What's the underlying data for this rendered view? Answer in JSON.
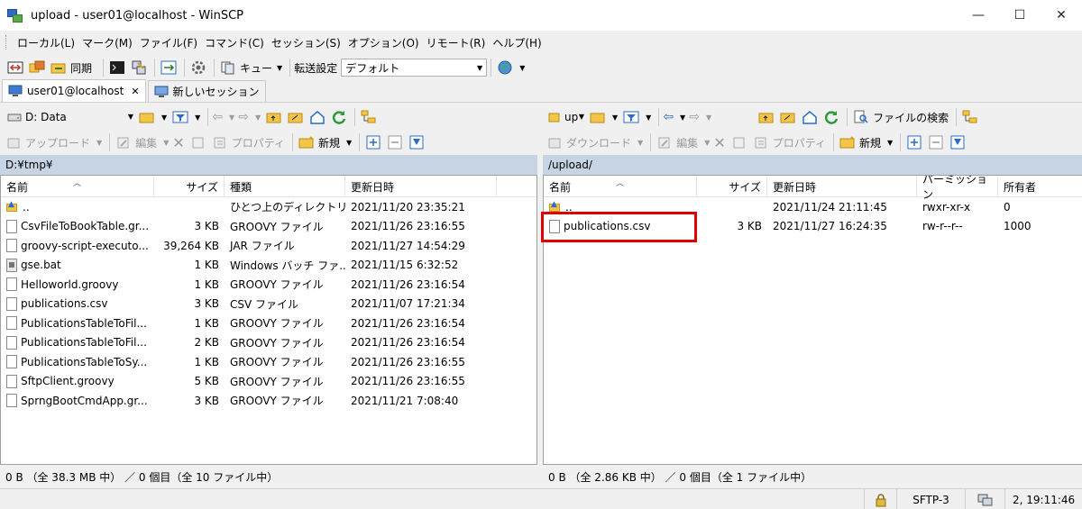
{
  "window": {
    "title": "upload - user01@localhost - WinSCP",
    "minimize": "—",
    "maximize": "☐",
    "close": "✕"
  },
  "menu": [
    "ローカル(L)",
    "マーク(M)",
    "ファイル(F)",
    "コマンド(C)",
    "セッション(S)",
    "オプション(O)",
    "リモート(R)",
    "ヘルプ(H)"
  ],
  "toolbar": {
    "sync": "同期",
    "queue": "キュー",
    "transfer_settings": "転送設定",
    "transfer_value": "デフォルト"
  },
  "tabs": {
    "session": "user01@localhost",
    "close": "✕",
    "new_session": "新しいセッション"
  },
  "local_toolbar": {
    "drive": "D: Data",
    "upload": "アップロード",
    "edit": "編集",
    "properties": "プロパティ",
    "new": "新規"
  },
  "remote_toolbar": {
    "drive": "up",
    "find": "ファイルの検索",
    "download": "ダウンロード",
    "edit": "編集",
    "properties": "プロパティ",
    "new": "新規"
  },
  "local": {
    "path": "D:¥tmp¥",
    "headers": {
      "name": "名前",
      "size": "サイズ",
      "type": "種類",
      "changed": "更新日時"
    },
    "files": [
      {
        "name": "..",
        "size": "",
        "type": "ひとつ上のディレクトリ",
        "changed": "2021/11/20  23:35:21",
        "icon": "up"
      },
      {
        "name": "CsvFileToBookTable.gr...",
        "size": "3 KB",
        "type": "GROOVY ファイル",
        "changed": "2021/11/26  23:16:55",
        "icon": "file"
      },
      {
        "name": "groovy-script-executo...",
        "size": "39,264 KB",
        "type": "JAR ファイル",
        "changed": "2021/11/27  14:54:29",
        "icon": "file"
      },
      {
        "name": "gse.bat",
        "size": "1 KB",
        "type": "Windows バッチ ファ...",
        "changed": "2021/11/15  6:32:52",
        "icon": "bat"
      },
      {
        "name": "Helloworld.groovy",
        "size": "1 KB",
        "type": "GROOVY ファイル",
        "changed": "2021/11/26  23:16:54",
        "icon": "file"
      },
      {
        "name": "publications.csv",
        "size": "3 KB",
        "type": "CSV ファイル",
        "changed": "2021/11/07  17:21:34",
        "icon": "file"
      },
      {
        "name": "PublicationsTableToFil...",
        "size": "1 KB",
        "type": "GROOVY ファイル",
        "changed": "2021/11/26  23:16:54",
        "icon": "file"
      },
      {
        "name": "PublicationsTableToFil...",
        "size": "2 KB",
        "type": "GROOVY ファイル",
        "changed": "2021/11/26  23:16:54",
        "icon": "file"
      },
      {
        "name": "PublicationsTableToSy...",
        "size": "1 KB",
        "type": "GROOVY ファイル",
        "changed": "2021/11/26  23:16:55",
        "icon": "file"
      },
      {
        "name": "SftpClient.groovy",
        "size": "5 KB",
        "type": "GROOVY ファイル",
        "changed": "2021/11/26  23:16:55",
        "icon": "file"
      },
      {
        "name": "SprngBootCmdApp.gr...",
        "size": "3 KB",
        "type": "GROOVY ファイル",
        "changed": "2021/11/21  7:08:40",
        "icon": "file"
      }
    ],
    "status": "0 B （全 38.3 MB 中） ／ 0 個目（全 10 ファイル中）"
  },
  "remote": {
    "path": "/upload/",
    "headers": {
      "name": "名前",
      "size": "サイズ",
      "changed": "更新日時",
      "rights": "パーミッション",
      "owner": "所有者"
    },
    "files": [
      {
        "name": "..",
        "size": "",
        "changed": "2021/11/24  21:11:45",
        "rights": "rwxr-xr-x",
        "owner": "0",
        "icon": "up"
      },
      {
        "name": "publications.csv",
        "size": "3 KB",
        "changed": "2021/11/27  16:24:35",
        "rights": "rw-r--r--",
        "owner": "1000",
        "icon": "file"
      }
    ],
    "status": "0 B （全 2.86 KB 中） ／ 0 個目（全 1 ファイル中）"
  },
  "statusbar": {
    "protocol": "SFTP-3",
    "time": "2, 19:11:46"
  },
  "colors": {
    "path_bar": "#c7d4e4",
    "highlight": "#e00000"
  }
}
